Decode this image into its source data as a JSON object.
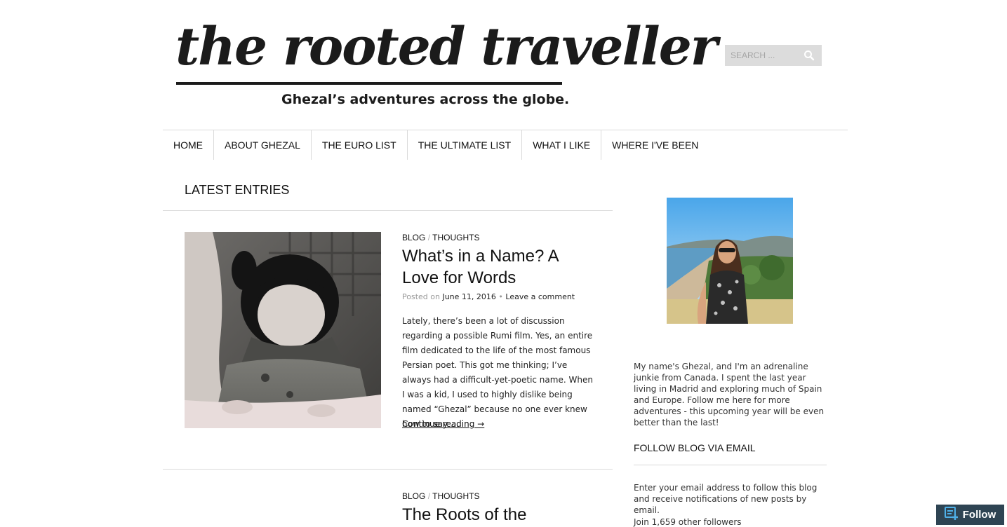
{
  "header": {
    "site_title": "the rooted traveller",
    "tagline": "Ghezal’s adventures across the globe.",
    "search_placeholder": "SEARCH ..."
  },
  "nav": {
    "items": [
      "HOME",
      "ABOUT GHEZAL",
      "THE EURO LIST",
      "THE ULTIMATE LIST",
      "WHAT I LIKE",
      "WHERE I'VE BEEN"
    ]
  },
  "main": {
    "section_title": "LATEST ENTRIES",
    "posts": [
      {
        "categories": [
          "BLOG",
          "THOUGHTS"
        ],
        "category_separator": "/",
        "title": "What’s in a Name? A Love for Words",
        "posted_on_label": "Posted on",
        "date": "June 11, 2016",
        "meta_separator": "•",
        "comment_link": "Leave a comment",
        "excerpt": "Lately, there’s been a lot of discussion regarding a possible Rumi film. Yes, an entire film dedicated to the life of the most famous Persian poet. This got me thinking; I’ve always had a difficult-yet-poetic name. When I was a kid, I used to highly dislike being named “Ghezal” because no one ever knew how to say …",
        "continue_label": "Continue reading →"
      },
      {
        "categories": [
          "BLOG",
          "THOUGHTS"
        ],
        "category_separator": "/",
        "title": "The Roots of the"
      }
    ]
  },
  "sidebar": {
    "about_text": "My name's Ghezal, and I'm an adrenaline junkie from Canada. I spent the last year living in Madrid and exploring much of Spain and Europe. Follow me here for more adventures - this upcoming year will be even better than the last!",
    "follow_title": "FOLLOW BLOG VIA EMAIL",
    "follow_text": "Enter your email address to follow this blog and receive notifications of new posts by email.",
    "followers_text": "Join 1,659 other followers"
  },
  "follow_button": {
    "label": "Follow"
  },
  "colors": {
    "accent": "#2e4453",
    "text": "#111111",
    "rule": "#dadada",
    "search_bg": "#dcdcdc"
  }
}
